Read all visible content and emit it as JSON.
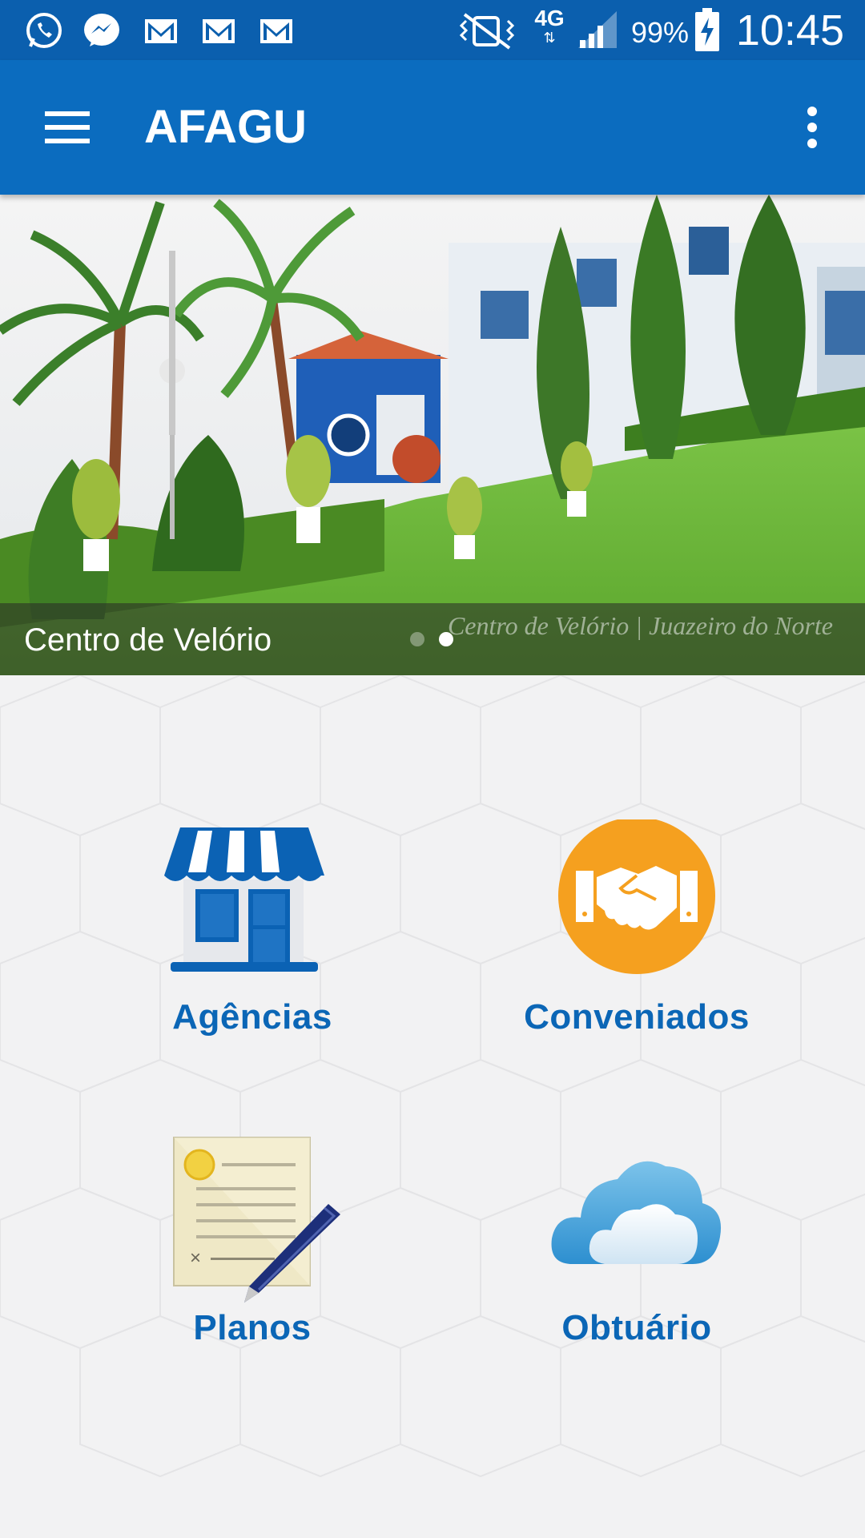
{
  "status_bar": {
    "battery_percent": "99%",
    "time": "10:45",
    "network": "4G",
    "icons": [
      "whatsapp-icon",
      "messenger-icon",
      "gmail-icon",
      "gmail-icon",
      "gmail-icon",
      "vibrate-icon",
      "network-4g-icon",
      "signal-icon",
      "battery-charging-icon"
    ]
  },
  "app_bar": {
    "title": "AFAGU",
    "menu_icon": "hamburger-menu-icon",
    "overflow_icon": "more-vert-icon"
  },
  "banner": {
    "caption": "Centro de Velório",
    "watermark": "Centro de Velório | Juazeiro do Norte",
    "slides": 2,
    "active_slide": 2
  },
  "menu": {
    "items": [
      {
        "label": "Agências",
        "icon": "store-icon"
      },
      {
        "label": "Conveniados",
        "icon": "handshake-icon"
      },
      {
        "label": "Planos",
        "icon": "document-pen-icon"
      },
      {
        "label": "Obtuário",
        "icon": "cloud-icon"
      }
    ]
  },
  "colors": {
    "status_bar": "#0b5fae",
    "app_bar": "#0b6cbf",
    "label_blue": "#0b66b6",
    "accent_orange": "#f5a01f"
  }
}
